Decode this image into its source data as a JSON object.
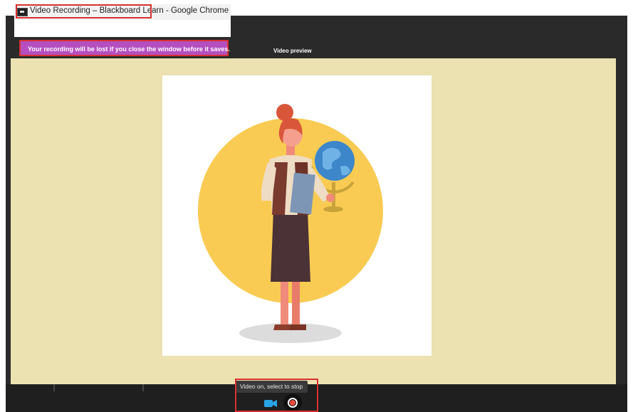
{
  "window": {
    "title": "Video Recording – Blackboard Learn - Google Chrome"
  },
  "banner": {
    "warning_text": "Your recording will be lost if you close the window before it saves."
  },
  "preview": {
    "label": "Video preview"
  },
  "controls": {
    "status_text": "Video on, select to stop",
    "camera_icon": "video-camera-icon",
    "record_icon": "record-icon"
  },
  "colors": {
    "warning_bg": "#b54fc0",
    "stage_bg": "#ece1b1",
    "app_bg": "#2a2a2a",
    "highlight": "#d93030",
    "camera_accent": "#29a3e6",
    "record_accent": "#e64a3c"
  }
}
